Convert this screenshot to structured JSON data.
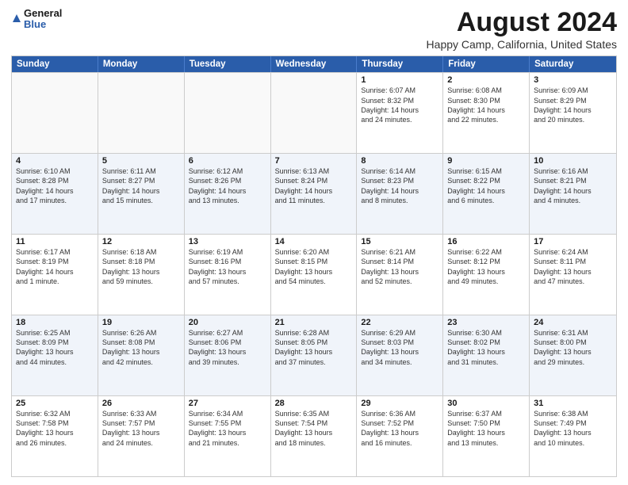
{
  "header": {
    "logo_line1": "General",
    "logo_line2": "Blue",
    "month_title": "August 2024",
    "location": "Happy Camp, California, United States"
  },
  "days_of_week": [
    "Sunday",
    "Monday",
    "Tuesday",
    "Wednesday",
    "Thursday",
    "Friday",
    "Saturday"
  ],
  "weeks": [
    [
      {
        "day": "",
        "info": ""
      },
      {
        "day": "",
        "info": ""
      },
      {
        "day": "",
        "info": ""
      },
      {
        "day": "",
        "info": ""
      },
      {
        "day": "1",
        "info": "Sunrise: 6:07 AM\nSunset: 8:32 PM\nDaylight: 14 hours\nand 24 minutes."
      },
      {
        "day": "2",
        "info": "Sunrise: 6:08 AM\nSunset: 8:30 PM\nDaylight: 14 hours\nand 22 minutes."
      },
      {
        "day": "3",
        "info": "Sunrise: 6:09 AM\nSunset: 8:29 PM\nDaylight: 14 hours\nand 20 minutes."
      }
    ],
    [
      {
        "day": "4",
        "info": "Sunrise: 6:10 AM\nSunset: 8:28 PM\nDaylight: 14 hours\nand 17 minutes."
      },
      {
        "day": "5",
        "info": "Sunrise: 6:11 AM\nSunset: 8:27 PM\nDaylight: 14 hours\nand 15 minutes."
      },
      {
        "day": "6",
        "info": "Sunrise: 6:12 AM\nSunset: 8:26 PM\nDaylight: 14 hours\nand 13 minutes."
      },
      {
        "day": "7",
        "info": "Sunrise: 6:13 AM\nSunset: 8:24 PM\nDaylight: 14 hours\nand 11 minutes."
      },
      {
        "day": "8",
        "info": "Sunrise: 6:14 AM\nSunset: 8:23 PM\nDaylight: 14 hours\nand 8 minutes."
      },
      {
        "day": "9",
        "info": "Sunrise: 6:15 AM\nSunset: 8:22 PM\nDaylight: 14 hours\nand 6 minutes."
      },
      {
        "day": "10",
        "info": "Sunrise: 6:16 AM\nSunset: 8:21 PM\nDaylight: 14 hours\nand 4 minutes."
      }
    ],
    [
      {
        "day": "11",
        "info": "Sunrise: 6:17 AM\nSunset: 8:19 PM\nDaylight: 14 hours\nand 1 minute."
      },
      {
        "day": "12",
        "info": "Sunrise: 6:18 AM\nSunset: 8:18 PM\nDaylight: 13 hours\nand 59 minutes."
      },
      {
        "day": "13",
        "info": "Sunrise: 6:19 AM\nSunset: 8:16 PM\nDaylight: 13 hours\nand 57 minutes."
      },
      {
        "day": "14",
        "info": "Sunrise: 6:20 AM\nSunset: 8:15 PM\nDaylight: 13 hours\nand 54 minutes."
      },
      {
        "day": "15",
        "info": "Sunrise: 6:21 AM\nSunset: 8:14 PM\nDaylight: 13 hours\nand 52 minutes."
      },
      {
        "day": "16",
        "info": "Sunrise: 6:22 AM\nSunset: 8:12 PM\nDaylight: 13 hours\nand 49 minutes."
      },
      {
        "day": "17",
        "info": "Sunrise: 6:24 AM\nSunset: 8:11 PM\nDaylight: 13 hours\nand 47 minutes."
      }
    ],
    [
      {
        "day": "18",
        "info": "Sunrise: 6:25 AM\nSunset: 8:09 PM\nDaylight: 13 hours\nand 44 minutes."
      },
      {
        "day": "19",
        "info": "Sunrise: 6:26 AM\nSunset: 8:08 PM\nDaylight: 13 hours\nand 42 minutes."
      },
      {
        "day": "20",
        "info": "Sunrise: 6:27 AM\nSunset: 8:06 PM\nDaylight: 13 hours\nand 39 minutes."
      },
      {
        "day": "21",
        "info": "Sunrise: 6:28 AM\nSunset: 8:05 PM\nDaylight: 13 hours\nand 37 minutes."
      },
      {
        "day": "22",
        "info": "Sunrise: 6:29 AM\nSunset: 8:03 PM\nDaylight: 13 hours\nand 34 minutes."
      },
      {
        "day": "23",
        "info": "Sunrise: 6:30 AM\nSunset: 8:02 PM\nDaylight: 13 hours\nand 31 minutes."
      },
      {
        "day": "24",
        "info": "Sunrise: 6:31 AM\nSunset: 8:00 PM\nDaylight: 13 hours\nand 29 minutes."
      }
    ],
    [
      {
        "day": "25",
        "info": "Sunrise: 6:32 AM\nSunset: 7:58 PM\nDaylight: 13 hours\nand 26 minutes."
      },
      {
        "day": "26",
        "info": "Sunrise: 6:33 AM\nSunset: 7:57 PM\nDaylight: 13 hours\nand 24 minutes."
      },
      {
        "day": "27",
        "info": "Sunrise: 6:34 AM\nSunset: 7:55 PM\nDaylight: 13 hours\nand 21 minutes."
      },
      {
        "day": "28",
        "info": "Sunrise: 6:35 AM\nSunset: 7:54 PM\nDaylight: 13 hours\nand 18 minutes."
      },
      {
        "day": "29",
        "info": "Sunrise: 6:36 AM\nSunset: 7:52 PM\nDaylight: 13 hours\nand 16 minutes."
      },
      {
        "day": "30",
        "info": "Sunrise: 6:37 AM\nSunset: 7:50 PM\nDaylight: 13 hours\nand 13 minutes."
      },
      {
        "day": "31",
        "info": "Sunrise: 6:38 AM\nSunset: 7:49 PM\nDaylight: 13 hours\nand 10 minutes."
      }
    ]
  ],
  "alt_rows": [
    1,
    3
  ]
}
